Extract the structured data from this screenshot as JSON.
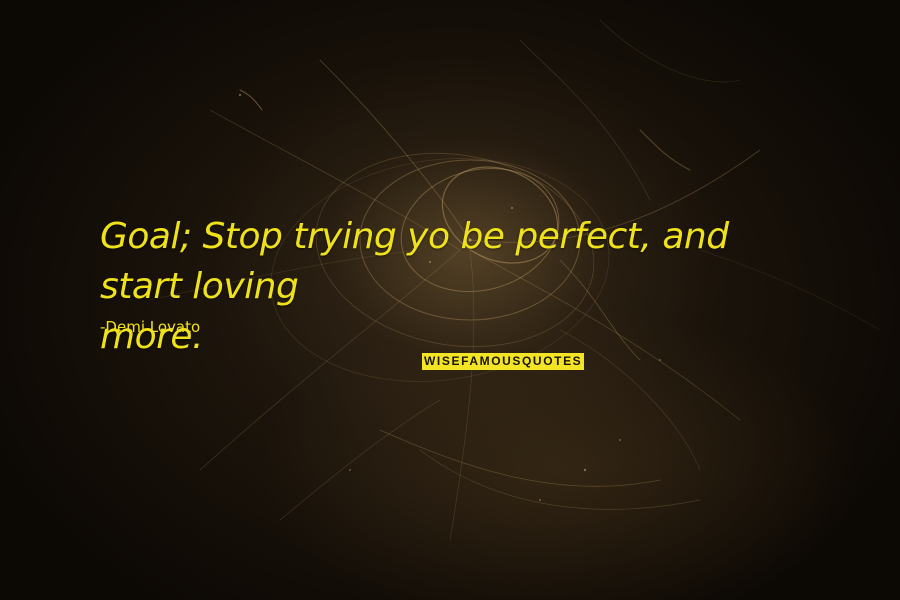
{
  "quote": {
    "line1": "Goal; Stop trying yo be perfect, and start loving",
    "line2": "more."
  },
  "author": {
    "prefix": "-",
    "name": "Demi Lovato"
  },
  "watermark": {
    "text": "WISEFAMOUSQUOTES"
  },
  "colors": {
    "text": "#efe21a",
    "watermark_bg": "#f3e526",
    "background": "#150f08"
  }
}
